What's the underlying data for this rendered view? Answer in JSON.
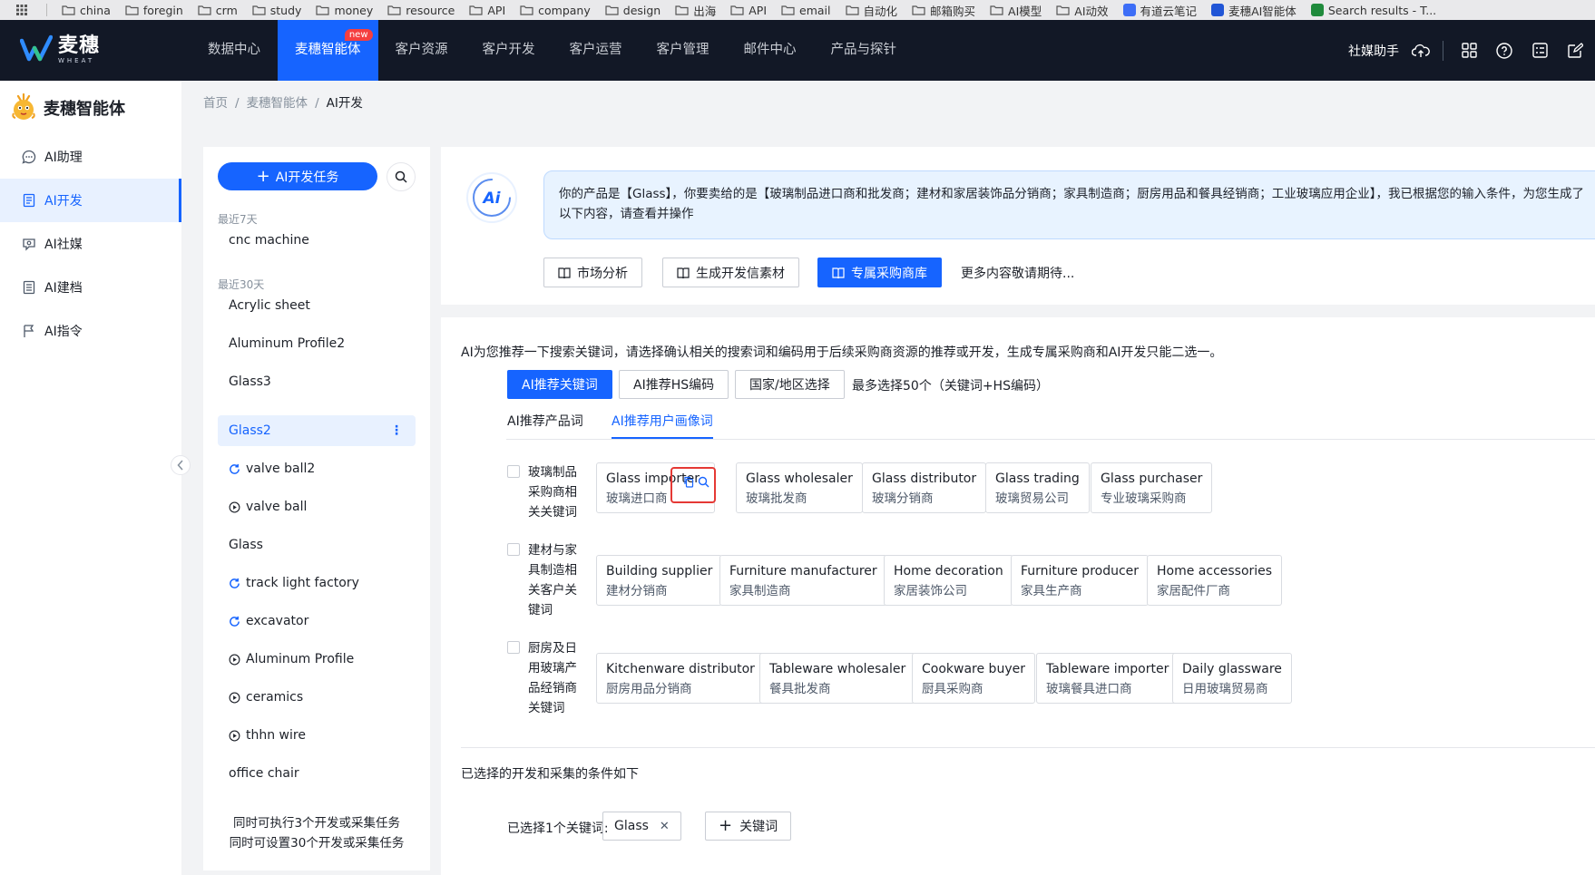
{
  "bookmarks": [
    "china",
    "foregin",
    "crm",
    "study",
    "money",
    "resource",
    "API",
    "company",
    "design",
    "出海",
    "API",
    "email",
    "自动化",
    "邮箱购买",
    "AI模型",
    "AI动效",
    "有道云笔记",
    "麦穗AI智能体",
    "Search results - T..."
  ],
  "brand": {
    "logo_cn": "麦穗",
    "logo_en": "WHEAT"
  },
  "topnav": {
    "items": [
      "数据中心",
      "麦穗智能体",
      "客户资源",
      "客户开发",
      "客户运营",
      "客户管理",
      "邮件中心",
      "产品与探针"
    ],
    "new_badge": "new",
    "helper": "社媒助手"
  },
  "sidebar": {
    "title": "麦穗智能体",
    "items": [
      "AI助理",
      "AI开发",
      "AI社媒",
      "AI建档",
      "AI指令"
    ]
  },
  "breadcrumb": [
    "首页",
    "麦穗智能体",
    "AI开发"
  ],
  "tasks": {
    "new_task": "AI开发任务",
    "group_7": "最近7天",
    "group_30": "最近30天",
    "recent7": [
      "cnc machine"
    ],
    "recent30": [
      "Acrylic sheet",
      "Aluminum Profile2",
      "Glass3",
      "Glass2",
      "valve ball2",
      "valve ball",
      "Glass",
      "track light factory",
      "excavator",
      "Aluminum Profile",
      "ceramics",
      "thhn wire",
      "office chair"
    ],
    "footer1": "同时可执行3个开发或采集任务",
    "footer2": "同时可设置30个开发或采集任务"
  },
  "chat": {
    "message": "你的产品是【Glass】，你要卖给的是【玻璃制品进口商和批发商；建材和家居装饰品分销商；家具制造商；厨房用品和餐具经销商；工业玻璃应用企业】，我已根据您的输入条件，为您生成了以下内容，请查看并操作",
    "actions": [
      "市场分析",
      "生成开发信素材",
      "专属采购商库"
    ],
    "more": "更多内容敬请期待..."
  },
  "main": {
    "intro": "AI为您推荐一下搜索关键词，请选择确认相关的搜索词和编码用于后续采购商资源的推荐或开发，生成专属采购商和AI开发只能二选一。",
    "tabs": [
      "AI推荐关键词",
      "AI推荐HS编码",
      "国家/地区选择"
    ],
    "max_note": "最多选择50个（关键词+HS编码）",
    "subtabs": [
      "AI推荐产品词",
      "AI推荐用户画像词"
    ],
    "groups": [
      {
        "label": "玻璃制品采购商相关关键词",
        "chips": [
          {
            "en": "Glass importer",
            "zh": "玻璃进口商"
          },
          {
            "en": "Glass wholesaler",
            "zh": "玻璃批发商"
          },
          {
            "en": "Glass distributor",
            "zh": "玻璃分销商"
          },
          {
            "en": "Glass trading",
            "zh": "玻璃贸易公司"
          },
          {
            "en": "Glass purchaser",
            "zh": "专业玻璃采购商"
          }
        ]
      },
      {
        "label": "建材与家具制造相关客户关键词",
        "chips": [
          {
            "en": "Building supplier",
            "zh": "建材分销商"
          },
          {
            "en": "Furniture manufacturer",
            "zh": "家具制造商"
          },
          {
            "en": "Home decoration",
            "zh": "家居装饰公司"
          },
          {
            "en": "Furniture producer",
            "zh": "家具生产商"
          },
          {
            "en": "Home accessories",
            "zh": "家居配件厂商"
          }
        ]
      },
      {
        "label": "厨房及日用玻璃产品经销商关键词",
        "chips": [
          {
            "en": "Kitchenware distributor",
            "zh": "厨房用品分销商"
          },
          {
            "en": "Tableware wholesaler",
            "zh": "餐具批发商"
          },
          {
            "en": "Cookware buyer",
            "zh": "厨具采购商"
          },
          {
            "en": "Tableware importer",
            "zh": "玻璃餐具进口商"
          },
          {
            "en": "Daily glassware",
            "zh": "日用玻璃贸易商"
          }
        ]
      }
    ],
    "selected_heading": "已选择的开发和采集的条件如下",
    "selected_label": "已选择1个关键词:",
    "selected_tag": "Glass",
    "add_keyword": "关键词"
  },
  "colors": {
    "primary": "#1664ff",
    "nav_bg": "#121826",
    "highlight": "#e53935"
  }
}
